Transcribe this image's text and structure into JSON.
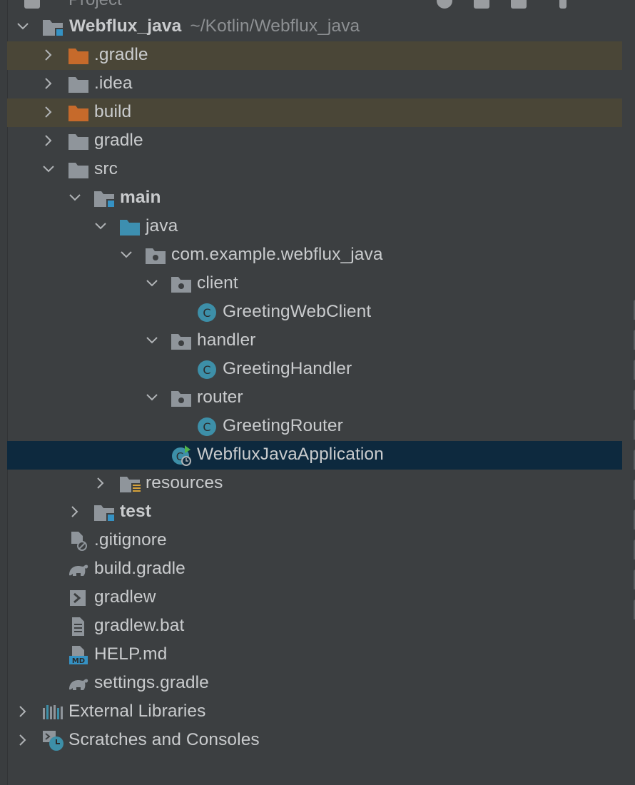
{
  "header": {
    "title": "Project"
  },
  "tree": {
    "root": {
      "name": "Webflux_java",
      "path": "~/Kotlin/Webflux_java"
    },
    "gradle_dir": ".gradle",
    "idea_dir": ".idea",
    "build_dir": "build",
    "gradle_folder": "gradle",
    "src": "src",
    "main": "main",
    "java": "java",
    "package": "com.example.webflux_java",
    "client": "client",
    "greeting_web_client": "GreetingWebClient",
    "handler": "handler",
    "greeting_handler": "GreetingHandler",
    "router": "router",
    "greeting_router": "GreetingRouter",
    "application": "WebfluxJavaApplication",
    "resources": "resources",
    "test": "test",
    "gitignore": ".gitignore",
    "build_gradle": "build.gradle",
    "gradlew": "gradlew",
    "gradlew_bat": "gradlew.bat",
    "help_md": "HELP.md",
    "settings_gradle": "settings.gradle",
    "external_libraries": "External Libraries",
    "scratches": "Scratches and Consoles"
  },
  "colors": {
    "background": "#3c3f41",
    "selected_row": "#0d293e",
    "excluded_row": "#4a4637",
    "folder_gray": "#8f959b",
    "folder_excluded": "#c66a2b",
    "source_blue": "#3592c4",
    "class_teal": "#3d8fa8"
  }
}
